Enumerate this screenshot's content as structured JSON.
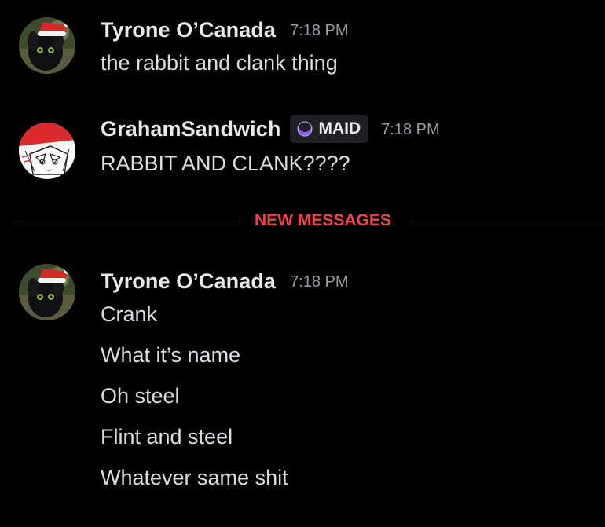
{
  "colors": {
    "background": "#000000",
    "username": "#e9eaec",
    "timestamp": "#9a9ba2",
    "message_text": "#dcdde0",
    "new_messages_accent": "#f0434a",
    "role_tag_bg": "#1f2024"
  },
  "messages": [
    {
      "author": "Tyrone O’Canada",
      "avatar_icon": "toothless-dragon-santa-hat-avatar",
      "timestamp": "7:18 PM",
      "lines": [
        "the rabbit and clank thing"
      ]
    },
    {
      "author": "GrahamSandwich",
      "avatar_icon": "anime-sketch-santa-hat-avatar",
      "role_tag": {
        "icon": "crescent-moon-icon",
        "label": "MAID"
      },
      "timestamp": "7:18 PM",
      "lines": [
        "RABBIT AND CLANK????"
      ]
    },
    {
      "author": "Tyrone O’Canada",
      "avatar_icon": "toothless-dragon-santa-hat-avatar",
      "timestamp": "7:18 PM",
      "lines": [
        "Crank",
        "What it’s name",
        "Oh steel",
        "Flint and steel",
        "Whatever same shit"
      ]
    }
  ],
  "divider": {
    "label": "NEW MESSAGES"
  }
}
